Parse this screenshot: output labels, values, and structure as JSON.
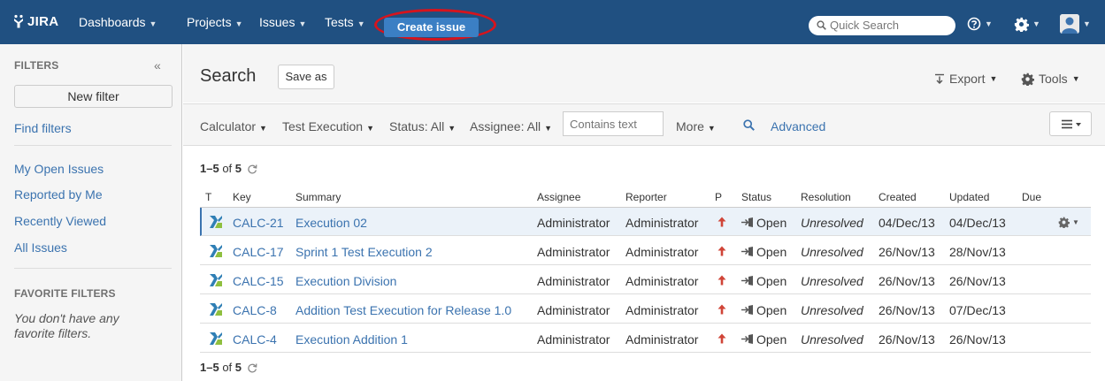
{
  "nav": {
    "logo_text": "JIRA",
    "dashboards": "Dashboards",
    "projects": "Projects",
    "issues": "Issues",
    "tests": "Tests",
    "create_issue": "Create issue",
    "quick_search_placeholder": "Quick Search",
    "caret": "▼"
  },
  "sidebar": {
    "filters_heading": "FILTERS",
    "collapse_glyph": "«",
    "new_filter": "New filter",
    "find_filters": "Find filters",
    "items": [
      {
        "label": "My Open Issues"
      },
      {
        "label": "Reported by Me"
      },
      {
        "label": "Recently Viewed"
      },
      {
        "label": "All Issues"
      }
    ],
    "favorite_heading": "FAVORITE FILTERS",
    "favorite_note": "You don't have any favorite filters."
  },
  "header": {
    "title": "Search",
    "save_as": "Save as",
    "export": "Export",
    "tools": "Tools"
  },
  "filterbar": {
    "project": "Calculator",
    "issue_type": "Test Execution",
    "status": "Status: All",
    "assignee": "Assignee: All",
    "text_placeholder": "Contains text",
    "more": "More",
    "advanced": "Advanced"
  },
  "results": {
    "range": "1–5",
    "of_label": "of",
    "total": "5",
    "columns": {
      "t": "T",
      "key": "Key",
      "summary": "Summary",
      "assignee": "Assignee",
      "reporter": "Reporter",
      "p": "P",
      "status": "Status",
      "resolution": "Resolution",
      "created": "Created",
      "updated": "Updated",
      "due": "Due"
    },
    "rows": [
      {
        "key": "CALC-21",
        "summary": "Execution 02",
        "assignee": "Administrator",
        "reporter": "Administrator",
        "status": "Open",
        "resolution": "Unresolved",
        "created": "04/Dec/13",
        "updated": "04/Dec/13",
        "due": ""
      },
      {
        "key": "CALC-17",
        "summary": "Sprint 1 Test Execution 2",
        "assignee": "Administrator",
        "reporter": "Administrator",
        "status": "Open",
        "resolution": "Unresolved",
        "created": "26/Nov/13",
        "updated": "28/Nov/13",
        "due": ""
      },
      {
        "key": "CALC-15",
        "summary": "Execution Division",
        "assignee": "Administrator",
        "reporter": "Administrator",
        "status": "Open",
        "resolution": "Unresolved",
        "created": "26/Nov/13",
        "updated": "26/Nov/13",
        "due": ""
      },
      {
        "key": "CALC-8",
        "summary": "Addition Test Execution for Release 1.0",
        "assignee": "Administrator",
        "reporter": "Administrator",
        "status": "Open",
        "resolution": "Unresolved",
        "created": "26/Nov/13",
        "updated": "07/Dec/13",
        "due": ""
      },
      {
        "key": "CALC-4",
        "summary": "Execution Addition 1",
        "assignee": "Administrator",
        "reporter": "Administrator",
        "status": "Open",
        "resolution": "Unresolved",
        "created": "26/Nov/13",
        "updated": "26/Nov/13",
        "due": ""
      }
    ]
  },
  "colors": {
    "topbar": "#205081",
    "link": "#3b73af",
    "create_button": "#3b7fc4",
    "highlight_ring": "#d6141d",
    "priority_arrow": "#d04437"
  },
  "icons": {
    "type": "test-execution-icon",
    "priority": "priority-major-icon",
    "status": "status-open-icon",
    "row_actions": "gear-icon"
  }
}
